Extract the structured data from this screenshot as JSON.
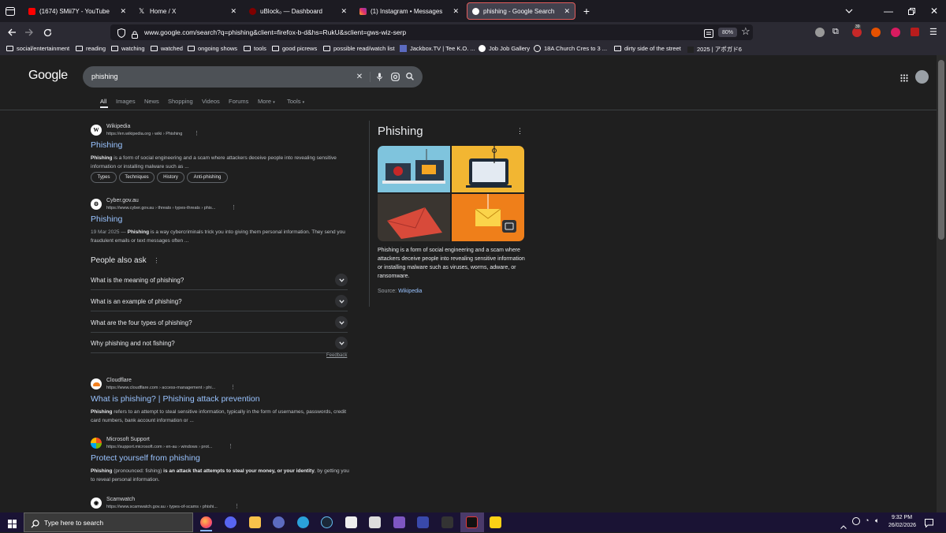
{
  "browser": {
    "tabs": [
      {
        "title": "(1674) SMii7Y - YouTube",
        "color": "#ff0000"
      },
      {
        "title": "Home / X",
        "color": "#ffffff"
      },
      {
        "title": "uBlock₀ — Dashboard",
        "color": "#800000"
      },
      {
        "title": "(1) Instagram • Messages",
        "color": "#e1306c"
      },
      {
        "title": "phishing - Google Search",
        "color": "#ffffff"
      }
    ],
    "active_tab": 4,
    "url": "www.google.com/search?q=phishing&client=firefox-b-d&hs=RukU&sclient=gws-wiz-serp",
    "zoom": "80%",
    "ext_badge": "39",
    "bookmarks": [
      "social/entertainment",
      "reading",
      "watching",
      "watched",
      "ongoing shows",
      "tools",
      "good picrews",
      "possible read/watch list",
      "Jackbox.TV | Tee K.O. ...",
      "Job Job Gallery",
      "18A Church Cres to 3 ...",
      "dirty side of the street",
      "2025 | アポガド6"
    ]
  },
  "google": {
    "logo": "Google",
    "query": "phishing",
    "tabs": [
      "All",
      "Images",
      "News",
      "Shopping",
      "Videos",
      "Forums",
      "More",
      "Tools"
    ],
    "results": [
      {
        "site": "Wikipedia",
        "url": "https://en.wikipedia.org › wiki › Phishing",
        "title": "Phishing",
        "snippet_bold": "Phishing",
        "snippet": " is a form of social engineering and a scam where attackers deceive people into revealing sensitive information or installing malware such as ...",
        "chips": [
          "Types",
          "Techniques",
          "History",
          "Anti-phishing"
        ]
      },
      {
        "site": "Cyber.gov.au",
        "url": "https://www.cyber.gov.au › threats › types-threats › phis...",
        "title": "Phishing",
        "date": "19 Mar 2025 — ",
        "snippet_bold": "Phishing",
        "snippet": " is a way cybercriminals trick you into giving them personal information. They send you fraudulent emails or text messages often ..."
      },
      {
        "site": "Cloudflare",
        "url": "https://www.cloudflare.com › access-management › phi...",
        "title": "What is phishing? | Phishing attack prevention",
        "snippet_bold": "Phishing",
        "snippet": " refers to an attempt to steal sensitive information, typically in the form of usernames, passwords, credit card numbers, bank account information or ..."
      },
      {
        "site": "Microsoft Support",
        "url": "https://support.microsoft.com › en-au › windows › prot...",
        "title": "Protect yourself from phishing",
        "snippet_bold": "Phishing",
        "snippet_mid": " (pronounced: fishing) ",
        "snippet_bold2": "is an attack that attempts to steal your money, or your identity",
        "snippet": ", by getting you to reveal personal information."
      },
      {
        "site": "Scamwatch",
        "url": "https://www.scamwatch.gov.au › types-of-scams › phishi..."
      }
    ],
    "people_also_ask": {
      "title": "People also ask",
      "questions": [
        "What is the meaning of phishing?",
        "What is an example of phishing?",
        "What are the four types of phishing?",
        "Why phishing and not fishing?"
      ],
      "feedback": "Feedback"
    },
    "knowledge_panel": {
      "title": "Phishing",
      "description": "Phishing is a form of social engineering and a scam where attackers deceive people into revealing sensitive information or installing malware such as viruses, worms, adware, or ransomware.",
      "source_label": "Source: ",
      "source": "Wikipedia"
    }
  },
  "taskbar": {
    "search_placeholder": "Type here to search",
    "time": "9:32 PM",
    "date": "26/02/2026"
  }
}
